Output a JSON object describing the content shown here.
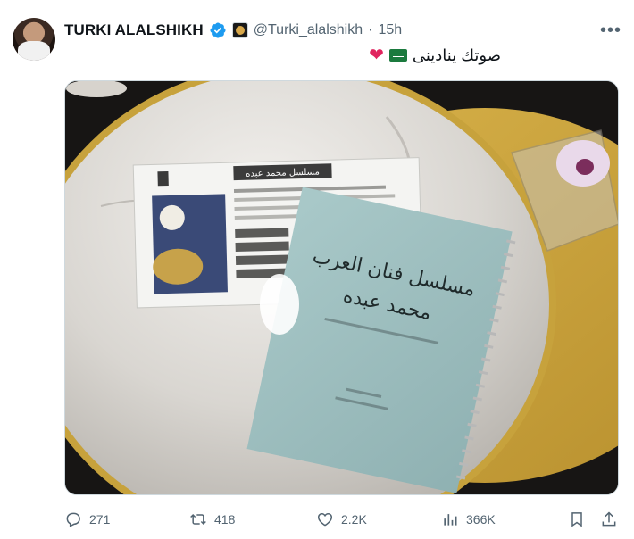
{
  "author": {
    "name": "TURKI ALALSHIKH",
    "handle": "@Turki_alalshikh",
    "separator": "·",
    "time": "15h"
  },
  "tweet": {
    "text": "صوتك ينادينى"
  },
  "photo": {
    "card_title": "مسلسل محمد عبده",
    "book_title_line1": "مسلسل فنان العرب",
    "book_title_line2": "محمد عبده"
  },
  "actions": {
    "replies": "271",
    "reposts": "418",
    "likes": "2.2K",
    "views": "366K"
  },
  "icons": [
    "more-icon",
    "verified-icon",
    "reply-icon",
    "repost-icon",
    "like-icon",
    "views-icon",
    "bookmark-icon",
    "share-icon",
    "heart-emoji-icon",
    "saudi-flag-icon"
  ],
  "colors": {
    "verified": "#1d9bf0",
    "muted": "#536471",
    "heart": "#e0245e"
  }
}
